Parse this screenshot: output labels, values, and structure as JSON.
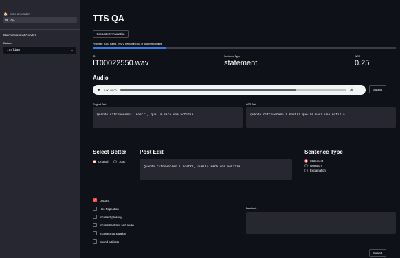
{
  "sidebar": {
    "nav": [
      {
        "icon": "🏠",
        "label": "intro annotator",
        "active": false
      },
      {
        "icon": "⚙",
        "label": "QA",
        "active": true
      }
    ],
    "welcome": "Welcome Ahmet Gunduz",
    "dataset_label": "Dataset",
    "dataset_value": "Italian"
  },
  "header": {
    "title": "TTS QA",
    "latest_button": "See Latest Annotation"
  },
  "progress": {
    "text": "Progress: 9387 Rated, 29472 Remaining out of 38859 recordings",
    "fraction": 0.2416,
    "color": "#2f7de1"
  },
  "meta": {
    "id_label": "ID",
    "id_value": "IT00022550.wav",
    "type_label": "Sentence Type",
    "type_value": "statement",
    "wer_label": "WER",
    "wer_value": "0.25"
  },
  "audio": {
    "heading": "Audio",
    "time": "0:00 / 0:00",
    "submit": "Submit"
  },
  "texts": {
    "original_label": "Original Text",
    "original_value": "Quando ritroveremo i nostri, quella sarà una notizia.",
    "asr_label": "ASR Text",
    "asr_value": "quando ritroveremo i nostri quella sarà una notizia"
  },
  "select_better": {
    "heading": "Select Better",
    "options": [
      "Original",
      "ASR"
    ],
    "selected": "Original"
  },
  "post_edit": {
    "heading": "Post Edit",
    "value": "Quando ritroveremo i nostri, quella sarà una notizia."
  },
  "sentence_type": {
    "heading": "Sentence Type",
    "options": [
      "Statement",
      "Question",
      "Exclamation"
    ],
    "selected": "Statement"
  },
  "flags": {
    "items": [
      {
        "label": "Discard",
        "checked": true
      },
      {
        "label": "Has Repeation",
        "checked": false
      },
      {
        "label": "Incorrect prosody",
        "checked": false
      },
      {
        "label": "Inconsistent text and audio",
        "checked": false
      },
      {
        "label": "Incorrect truncuation",
        "checked": false
      },
      {
        "label": "Sound artifacts",
        "checked": false
      }
    ],
    "feedback_label": "Feedback",
    "submit": "Submit"
  },
  "colors": {
    "accent": "#ff4b4b",
    "background": "#0e1117",
    "sidebar": "#262730"
  }
}
